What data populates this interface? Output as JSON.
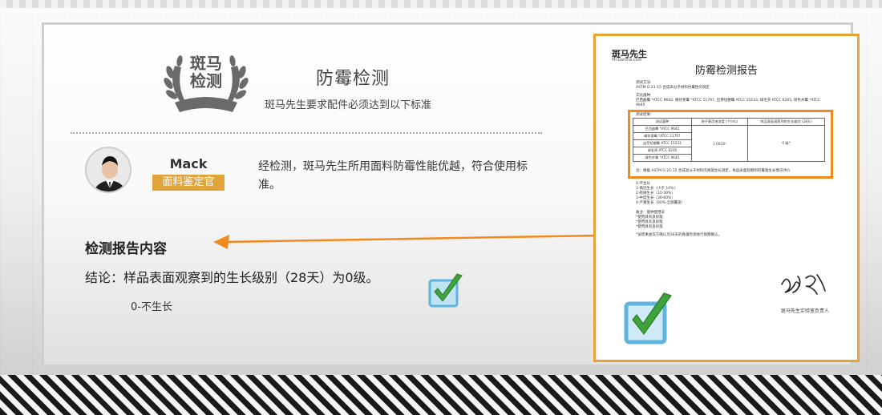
{
  "badge": {
    "line1": "斑马",
    "line2": "检测"
  },
  "header": {
    "title": "防霉检测",
    "subtitle": "斑马先生要求配件必须达到以下标准"
  },
  "inspector": {
    "name": "Mack",
    "role": "面料鉴定官",
    "quote": "经检测，斑马先生所用面料防霉性能优越，符合使用标准。"
  },
  "report_section": {
    "heading": "检测报告内容",
    "conclusion": "结论：样品表面观察到的生长级别（28天）为0级。",
    "level_note": "0-不生长"
  },
  "report": {
    "logo": "斑马先生",
    "logo_sub": "Mr-banma.com",
    "title": "防霉检测报告",
    "method_label": "测试方法:",
    "method_text": "ASTM G 21-15 合成高分子材料抗霉性的测定",
    "strain_label": "实验菌种:",
    "strain_text": "巴西曲霉 *ATCC 9642, 绳状青霉 *ATCC 11797, 出芽短梗霉 ATCC 15233, 球毛壳 ATCC 6205, 绿色木霉 *ATCC 9645",
    "result_label": "测试结果:",
    "table_headers": [
      "测试菌种",
      "孢子悬浮液浓度 (个/mL)",
      "样品表面观察到的生长级别 (28天)"
    ],
    "table_rows": [
      "巴西曲霉 *ATCC 9642",
      "绳状青霉 *ATCC 11797",
      "出芽短梗霉 ATCC 15233",
      "球毛壳 ATCC 6205",
      "绿色木霉 *ATCC 9645"
    ],
    "concentration": "1.0X10⁶",
    "grade": "0 级*",
    "note_line": "注：根据 ASTM G 21-15 合成高分子材料的真菌生长测定，样品表面观察到的霉菌生长情况评价",
    "levels": [
      "0-不生长",
      "1-痕迹生长（小于 10%）",
      "2-轻微生长（10-30%）",
      "3-中度生长（30-60%）",
      "4-严重生长（60%-全部覆盖）"
    ],
    "remark_label": "备注：菌种使用说",
    "remarks": [
      "*使用具有良好能",
      "*使用具有良好能",
      "*使用具有良好能"
    ],
    "footnote": "*该结果由双方确认为30天的真菌检测进行观察确认。",
    "sign_label": "斑马先生实验室负责人"
  }
}
